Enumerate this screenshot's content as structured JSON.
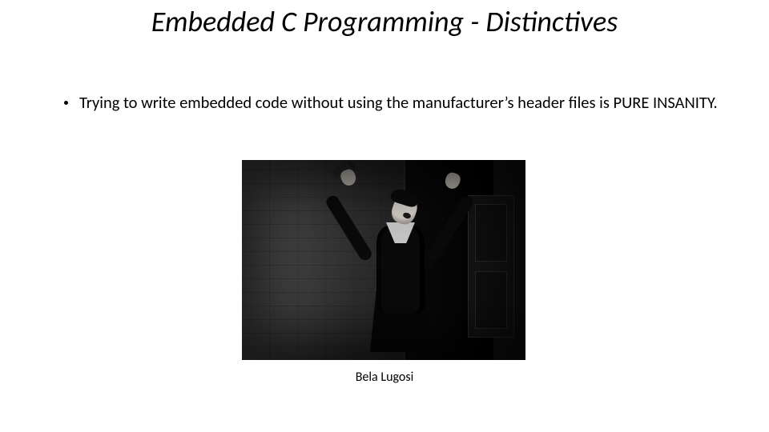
{
  "title": "Embedded C Programming - Distinctives",
  "bullets": [
    "Trying to write embedded code without using the manufacturer’s header files is PURE INSANITY."
  ],
  "image_caption": "Bela Lugosi"
}
